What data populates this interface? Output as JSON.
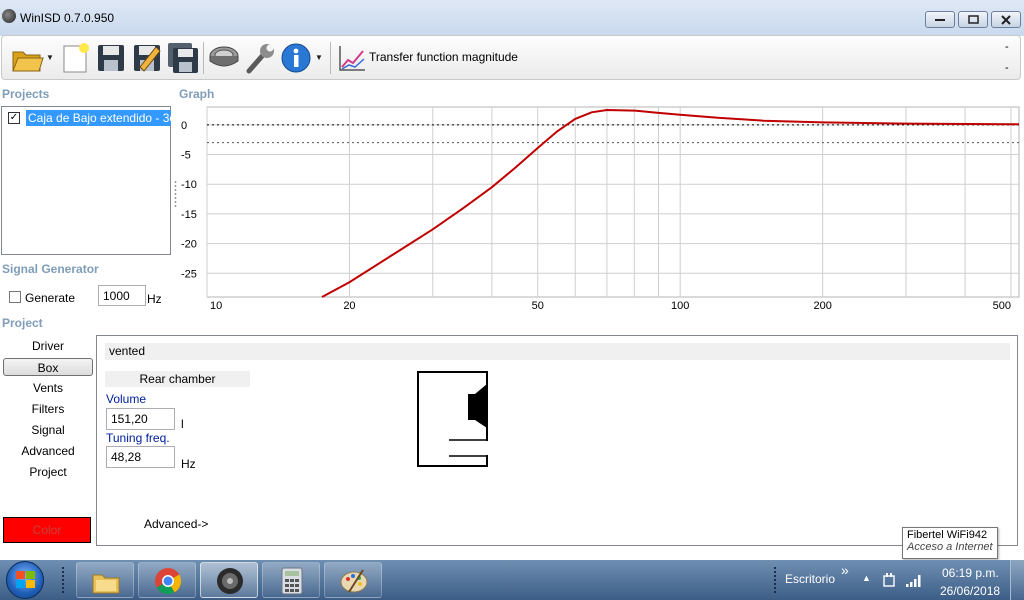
{
  "window": {
    "title": "WinISD 0.7.0.950"
  },
  "toolbar": {
    "graph_type_label": "Transfer function magnitude",
    "right_dash_top": "-",
    "right_dash_bottom": "-"
  },
  "projects": {
    "section_label": "Projects",
    "items": [
      {
        "name": "Caja de Bajo extendido - 3c",
        "checked": true,
        "check_mark": "✓"
      }
    ]
  },
  "graph": {
    "section_label": "Graph"
  },
  "chart_data": {
    "type": "line",
    "title": "",
    "xlabel": "",
    "ylabel": "",
    "x_scale": "log",
    "xlim": [
      10,
      520
    ],
    "ylim": [
      -29,
      3
    ],
    "x_ticks": [
      10,
      20,
      50,
      100,
      200,
      500
    ],
    "x_tick_labels": [
      "10",
      "20",
      "50",
      "100",
      "200",
      "500"
    ],
    "y_ticks": [
      0,
      -5,
      -10,
      -15,
      -20,
      -25
    ],
    "y_tick_labels": [
      "0",
      "-5",
      "-10",
      "-15",
      "-20",
      "-25"
    ],
    "reference_lines": [
      0,
      -3
    ],
    "grid": true,
    "series": [
      {
        "color": "#c00000",
        "x": [
          17.5,
          20,
          25,
          30,
          35,
          40,
          45,
          50,
          55,
          60,
          65,
          70,
          80,
          90,
          100,
          120,
          150,
          200,
          300,
          500,
          520
        ],
        "y": [
          -29,
          -26.5,
          -21.6,
          -17.6,
          -13.9,
          -10.5,
          -7.1,
          -3.9,
          -1.1,
          1.0,
          2.1,
          2.5,
          2.4,
          2.0,
          1.7,
          1.2,
          0.7,
          0.4,
          0.2,
          0.1,
          0.1
        ]
      }
    ]
  },
  "signal_generator": {
    "section_label": "Signal Generator",
    "generate_label": "Generate",
    "frequency": "1000",
    "unit": "Hz"
  },
  "project_nav": {
    "section_label": "Project",
    "items": [
      "Driver",
      "Box",
      "Vents",
      "Filters",
      "Signal",
      "Advanced",
      "Project"
    ],
    "active": "Box",
    "color_label": "Color",
    "color_value": "#ff0000"
  },
  "box_panel": {
    "box_type": "vented",
    "rear_chamber_label": "Rear chamber",
    "volume_label": "Volume",
    "volume_value": "151,20",
    "volume_unit": "l",
    "tuning_label": "Tuning freq.",
    "tuning_value": "48,28",
    "tuning_unit": "Hz",
    "advanced_link": "Advanced->"
  },
  "tooltip": {
    "line1": "Fibertel WiFi942",
    "line2": "Acceso a Internet"
  },
  "taskbar": {
    "desktop_label": "Escritorio",
    "chevron": "»",
    "time": "06:19 p.m.",
    "date": "26/06/2018"
  }
}
